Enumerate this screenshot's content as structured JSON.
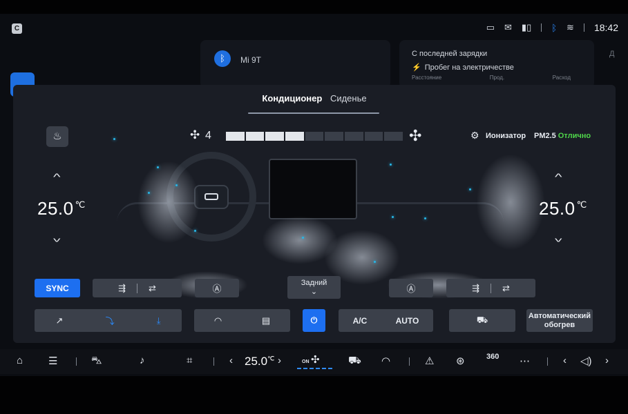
{
  "status_bar": {
    "app_badge": "C",
    "time": "18:42"
  },
  "background": {
    "bluetooth_device": "Mi 9T",
    "charge_title": "С последней зарядки",
    "charge_subtitle": "Пробег на электричестве",
    "charge_columns": [
      "Расстояние",
      "Прод.",
      "Расход"
    ],
    "cut_label": "Д"
  },
  "climate": {
    "tabs": [
      {
        "label": "Кондиционер",
        "active": true
      },
      {
        "label": "Сиденье",
        "active": false
      }
    ],
    "fan": {
      "level_text": "4",
      "level": 4,
      "max": 9
    },
    "ionizer_label": "Ионизатор",
    "pm_label": "PM2.5",
    "pm_status": "Отлично",
    "pm_status_color": "#4fd64a",
    "left_temp": "25.0",
    "right_temp": "25.0",
    "temp_unit": "℃",
    "sync_label": "SYNC",
    "rear_label": "Задний",
    "ac_label": "A/C",
    "auto_label": "AUTO",
    "auto_heat_line1": "Автоматический",
    "auto_heat_line2": "обогрев",
    "accent_color": "#1d6ff0"
  },
  "dock": {
    "temp": "25.0",
    "temp_unit": "℃",
    "fan_on_label": "ON",
    "view_360": "360"
  }
}
